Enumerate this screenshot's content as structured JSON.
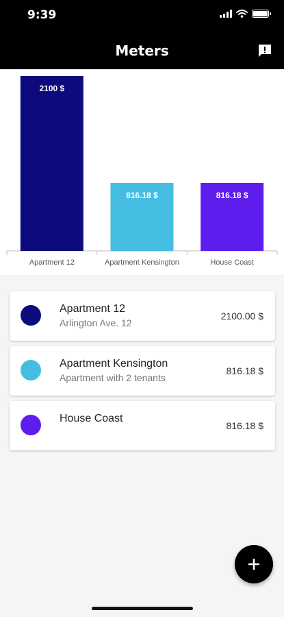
{
  "status_bar": {
    "time": "9:39"
  },
  "app_bar": {
    "title": "Meters",
    "action_icon": "feedback-icon"
  },
  "chart_data": {
    "type": "bar",
    "categories": [
      "Apartment 12",
      "Apartment Kensington",
      "House Coast"
    ],
    "values": [
      2100,
      816.18,
      816.18
    ],
    "data_labels": [
      "2100 $",
      "816.18 $",
      "816.18 $"
    ],
    "colors": [
      "#0d0a7e",
      "#45bde3",
      "#5d1ded"
    ],
    "ylim": [
      0,
      2100
    ],
    "grid": false,
    "title": "",
    "xlabel": "",
    "ylabel": ""
  },
  "meters": [
    {
      "name": "Apartment 12",
      "description": "Arlington Ave. 12",
      "amount": "2100.00 $",
      "color": "#0d0a7e"
    },
    {
      "name": "Apartment Kensington",
      "description": "Apartment with 2 tenants",
      "amount": "816.18 $",
      "color": "#45bde3"
    },
    {
      "name": "House Coast",
      "description": "",
      "amount": "816.18 $",
      "color": "#5d1ded"
    }
  ],
  "fab": {
    "icon": "plus-icon"
  }
}
